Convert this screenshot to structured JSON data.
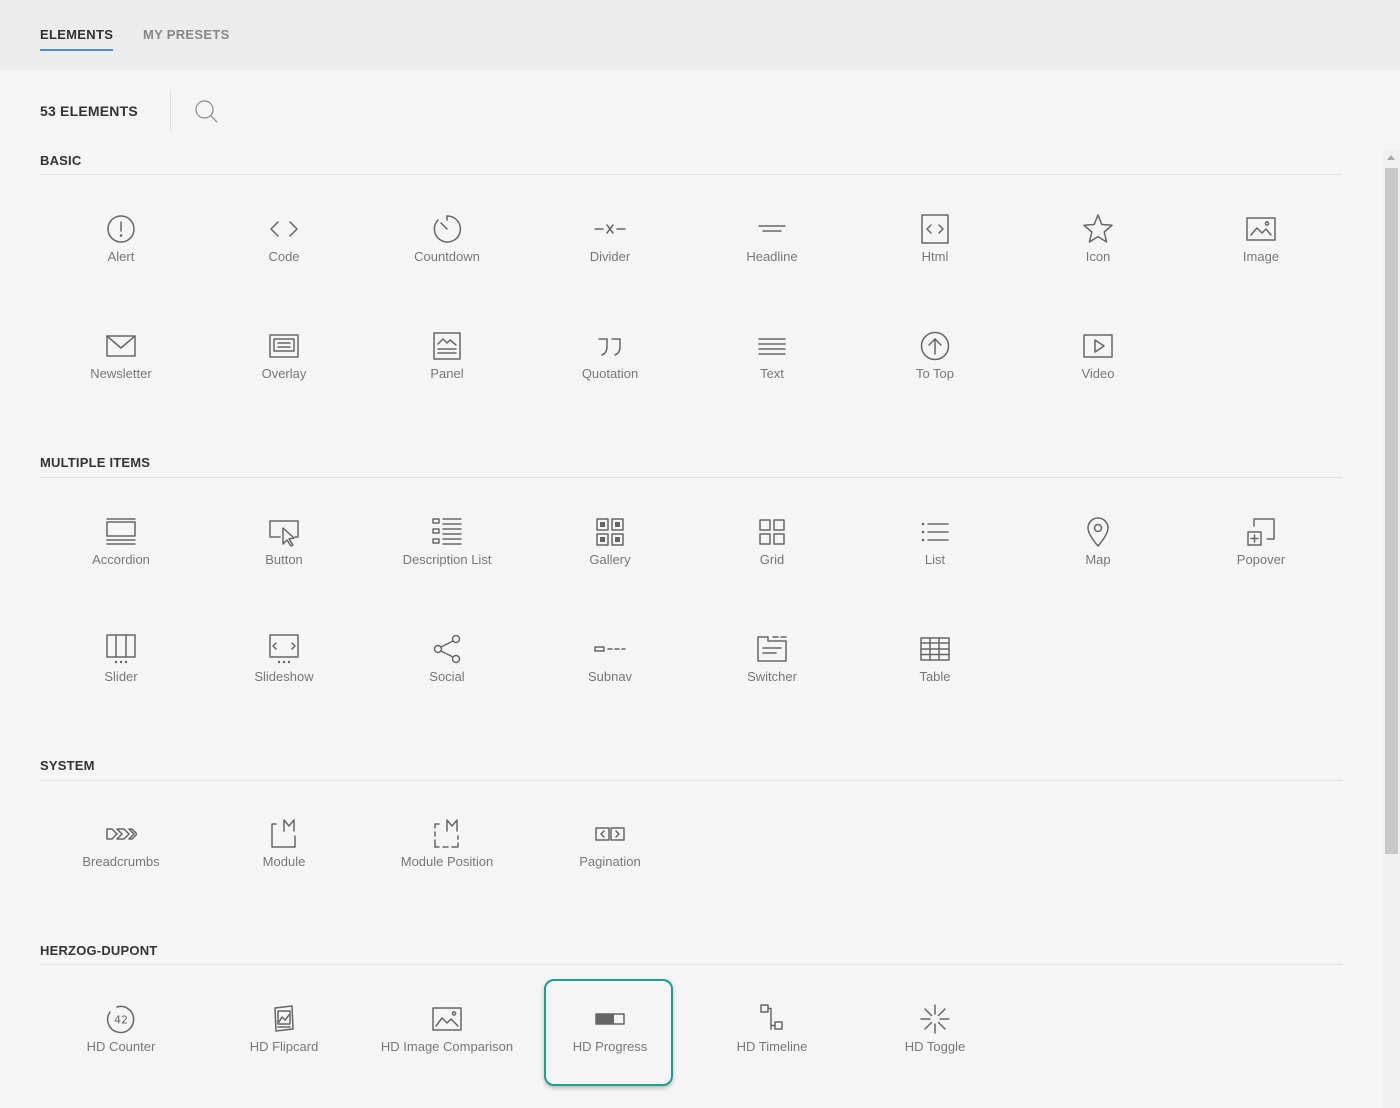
{
  "tabs": [
    {
      "label": "ELEMENTS",
      "active": true
    },
    {
      "label": "MY PRESETS",
      "active": false
    }
  ],
  "element_count_label": "53 ELEMENTS",
  "search_icon": "search-icon",
  "accent_color": "#4a90d9",
  "highlight_color": "#1f9e8c",
  "sections": [
    {
      "title": "BASIC",
      "items": [
        {
          "label": "Alert",
          "icon": "alert-icon"
        },
        {
          "label": "Code",
          "icon": "code-icon"
        },
        {
          "label": "Countdown",
          "icon": "countdown-icon"
        },
        {
          "label": "Divider",
          "icon": "divider-icon"
        },
        {
          "label": "Headline",
          "icon": "headline-icon"
        },
        {
          "label": "Html",
          "icon": "html-icon"
        },
        {
          "label": "Icon",
          "icon": "star-icon"
        },
        {
          "label": "Image",
          "icon": "image-icon"
        },
        {
          "label": "Newsletter",
          "icon": "envelope-icon"
        },
        {
          "label": "Overlay",
          "icon": "overlay-icon"
        },
        {
          "label": "Panel",
          "icon": "panel-icon"
        },
        {
          "label": "Quotation",
          "icon": "quotation-icon"
        },
        {
          "label": "Text",
          "icon": "text-icon"
        },
        {
          "label": "To Top",
          "icon": "arrow-up-circle-icon"
        },
        {
          "label": "Video",
          "icon": "play-icon"
        }
      ]
    },
    {
      "title": "MULTIPLE ITEMS",
      "items": [
        {
          "label": "Accordion",
          "icon": "accordion-icon"
        },
        {
          "label": "Button",
          "icon": "button-cursor-icon"
        },
        {
          "label": "Description List",
          "icon": "description-list-icon"
        },
        {
          "label": "Gallery",
          "icon": "gallery-icon"
        },
        {
          "label": "Grid",
          "icon": "grid-icon"
        },
        {
          "label": "List",
          "icon": "list-icon"
        },
        {
          "label": "Map",
          "icon": "map-pin-icon"
        },
        {
          "label": "Popover",
          "icon": "popover-icon"
        },
        {
          "label": "Slider",
          "icon": "slider-icon"
        },
        {
          "label": "Slideshow",
          "icon": "slideshow-icon"
        },
        {
          "label": "Social",
          "icon": "share-icon"
        },
        {
          "label": "Subnav",
          "icon": "subnav-icon"
        },
        {
          "label": "Switcher",
          "icon": "switcher-icon"
        },
        {
          "label": "Table",
          "icon": "table-icon"
        }
      ]
    },
    {
      "title": "SYSTEM",
      "items": [
        {
          "label": "Breadcrumbs",
          "icon": "breadcrumbs-icon"
        },
        {
          "label": "Module",
          "icon": "module-icon"
        },
        {
          "label": "Module Position",
          "icon": "module-position-icon"
        },
        {
          "label": "Pagination",
          "icon": "pagination-icon"
        }
      ]
    },
    {
      "title": "HERZOG-DUPONT",
      "items": [
        {
          "label": "HD Counter",
          "icon": "counter-icon",
          "icon_text": "42"
        },
        {
          "label": "HD Flipcard",
          "icon": "flipcard-icon"
        },
        {
          "label": "HD Image Comparison",
          "icon": "image-comparison-icon"
        },
        {
          "label": "HD Progress",
          "icon": "progress-bar-icon",
          "highlighted": true
        },
        {
          "label": "HD Timeline",
          "icon": "timeline-icon"
        },
        {
          "label": "HD Toggle",
          "icon": "toggle-icon"
        }
      ]
    }
  ]
}
